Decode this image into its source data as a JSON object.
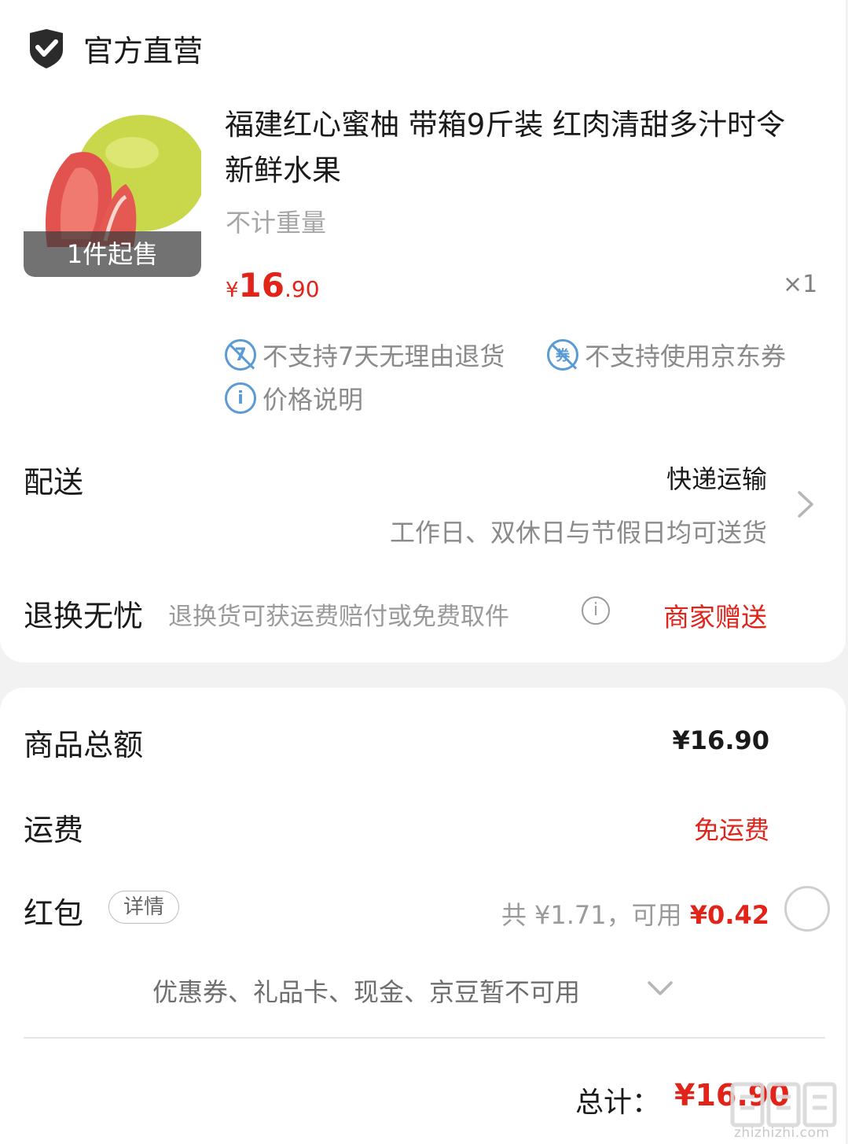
{
  "shop": {
    "title": "官方直营",
    "icon": "shield-check-icon"
  },
  "product": {
    "title": "福建红心蜜柚 带箱9斤装 红肉清甜多汁时令新鲜水果",
    "min_order_badge": "1件起售",
    "spec": "不计重量",
    "price": {
      "currency": "¥",
      "integer": "16",
      "decimal": ".90"
    },
    "quantity": "×1",
    "policies": [
      {
        "icon": "no-7day-return-icon",
        "icon_char": "7",
        "label": "不支持7天无理由退货"
      },
      {
        "icon": "no-coupon-icon",
        "icon_char": "券",
        "label": "不支持使用京东券"
      },
      {
        "icon": "info-icon",
        "icon_char": "i",
        "label": "价格说明"
      }
    ]
  },
  "delivery": {
    "label": "配送",
    "method": "快递运输",
    "note": "工作日、双休日与节假日均可送货"
  },
  "returns": {
    "label": "退换无忧",
    "description": "退换货可获运费赔付或免费取件",
    "info_icon_char": "i",
    "badge": "商家赠送"
  },
  "summary": {
    "goods_total_label": "商品总额",
    "goods_total_value": "¥16.90",
    "shipping_label": "运费",
    "shipping_value": "免运费",
    "red_packet_label": "红包",
    "red_packet_detail": "详情",
    "red_packet_total": "共 ¥1.71，可用 ",
    "red_packet_available": "¥0.42",
    "unavailable_note": "优惠券、礼品卡、现金、京豆暂不可用",
    "grand_total_label": "总计：",
    "grand_total_value": "¥16.90"
  },
  "watermark": {
    "text": "zhizhizhi.com"
  },
  "colors": {
    "accent_red": "#e2231a",
    "policy_blue": "#5b9bd5",
    "muted_gray": "#8a8a8a",
    "page_bg": "#f2f2f2"
  }
}
